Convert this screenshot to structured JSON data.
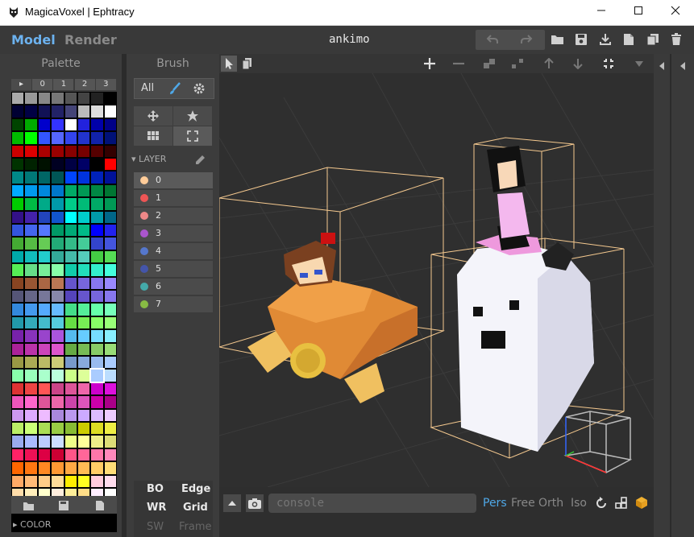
{
  "window": {
    "title": "MagicaVoxel | Ephtracy"
  },
  "header": {
    "model_tab": "Model",
    "render_tab": "Render",
    "doc_title": "ankimo"
  },
  "palette": {
    "title": "Palette",
    "tabs": [
      "▸",
      "0",
      "1",
      "2",
      "3"
    ],
    "footer_label": "COLOR",
    "rows": [
      [
        "#aaaaaa",
        "#999999",
        "#888888",
        "#777777",
        "#555555",
        "#444444",
        "#222222",
        "#000000"
      ],
      [
        "#000033",
        "#000044",
        "#111155",
        "#222266",
        "#444477",
        "#bbbbbb",
        "#dddddd",
        "#ffffff"
      ],
      [
        "#004400",
        "#00aa00",
        "#0000cc",
        "#3333ff",
        "#ffffff",
        "#2222dd",
        "#0000aa",
        "#000088"
      ],
      [
        "#00bb00",
        "#00ff00",
        "#3355ff",
        "#5566ff",
        "#3344ee",
        "#2233cc",
        "#1122aa",
        "#001177"
      ],
      [
        "#cc0000",
        "#dd0000",
        "#aa0000",
        "#990000",
        "#880000",
        "#770000",
        "#550000",
        "#330000"
      ],
      [
        "#003300",
        "#002200",
        "#001100",
        "#000022",
        "#000044",
        "#000066",
        "#000000",
        "#ff0000"
      ],
      [
        "#008888",
        "#007777",
        "#006666",
        "#005555",
        "#0044ff",
        "#0033dd",
        "#0022bb",
        "#001199"
      ],
      [
        "#00aaff",
        "#0099ee",
        "#0088dd",
        "#0077cc",
        "#00aa66",
        "#009955",
        "#008844",
        "#007733"
      ],
      [
        "#00cc00",
        "#00bb44",
        "#00aa88",
        "#0099aa",
        "#00cc88",
        "#00bb77",
        "#00aa66",
        "#009955"
      ],
      [
        "#331188",
        "#4422aa",
        "#2244bb",
        "#1155cc",
        "#00ffff",
        "#00cccc",
        "#0099aa",
        "#006688"
      ],
      [
        "#3355dd",
        "#4466ee",
        "#5577ff",
        "#009966",
        "#00aa77",
        "#00bb88",
        "#0000ff",
        "#2222ee"
      ],
      [
        "#44aa33",
        "#55bb44",
        "#66cc55",
        "#22aa77",
        "#33bb88",
        "#44cc99",
        "#3344cc",
        "#4455dd"
      ],
      [
        "#00aaaa",
        "#11bbbb",
        "#22cccc",
        "#33aa99",
        "#44bbaa",
        "#55ccbb",
        "#44cc44",
        "#55dd55"
      ],
      [
        "#55ee55",
        "#66dd88",
        "#77ee99",
        "#88ffaa",
        "#11ccaa",
        "#22ddbb",
        "#33eecc",
        "#44ffdd"
      ],
      [
        "#884422",
        "#995533",
        "#aa6644",
        "#bb7755",
        "#6655cc",
        "#7766dd",
        "#8877ee",
        "#9988ff"
      ],
      [
        "#555577",
        "#666688",
        "#777799",
        "#8888aa",
        "#5544bb",
        "#6655cc",
        "#7766dd",
        "#8877ee"
      ],
      [
        "#3388dd",
        "#4499ee",
        "#55aaff",
        "#66bbff",
        "#44dd88",
        "#55ee99",
        "#66ffaa",
        "#77ffbb"
      ],
      [
        "#2299aa",
        "#33aabb",
        "#44bbcc",
        "#55ccdd",
        "#66dd44",
        "#77ee55",
        "#88ff66",
        "#99ff77"
      ],
      [
        "#7722aa",
        "#8833bb",
        "#9944cc",
        "#aa55dd",
        "#55bbee",
        "#66ccff",
        "#77ddff",
        "#88eeff"
      ],
      [
        "#aa2299",
        "#bb33aa",
        "#cc44bb",
        "#dd55cc",
        "#66aa44",
        "#77bb55",
        "#88cc66",
        "#99dd77"
      ],
      [
        "#999944",
        "#aaaa55",
        "#bbbb66",
        "#cccc77",
        "#7799cc",
        "#88aadd",
        "#99bbee",
        "#aaccff"
      ],
      [
        "#88ffaa",
        "#99ffbb",
        "#aaffcc",
        "#bbffdd",
        "#ccff88",
        "#ddff99",
        "#aaccff",
        "#bbddff"
      ],
      [
        "#dd3333",
        "#ee4444",
        "#ff5555",
        "#cc4488",
        "#dd5599",
        "#ee66aa",
        "#cc00cc",
        "#dd11dd"
      ],
      [
        "#ee55bb",
        "#ff66cc",
        "#dd5599",
        "#ee66aa",
        "#cc44aa",
        "#dd55bb",
        "#cc00aa",
        "#aa0088"
      ],
      [
        "#cc99ee",
        "#ddaaff",
        "#eebbff",
        "#aa88dd",
        "#bb99ee",
        "#ccaaff",
        "#ddbbff",
        "#eeccff"
      ],
      [
        "#bbee66",
        "#ccff77",
        "#aadd55",
        "#99cc44",
        "#88bb33",
        "#cccc00",
        "#dddd22",
        "#eeee44"
      ],
      [
        "#99aaee",
        "#aabbff",
        "#bbccff",
        "#ccddff",
        "#eeff88",
        "#ffff99",
        "#eeee88",
        "#dddd77"
      ],
      [
        "#ff2266",
        "#ee1155",
        "#dd0044",
        "#cc0033",
        "#ff5588",
        "#ff6699",
        "#ff77aa",
        "#ff88bb"
      ],
      [
        "#ff6600",
        "#ff7711",
        "#ff8822",
        "#ff9933",
        "#ffaa44",
        "#ffbb55",
        "#ffcc66",
        "#ffdd77"
      ],
      [
        "#ffaa66",
        "#ffbb77",
        "#ffcc88",
        "#ffdd99",
        "#ffee00",
        "#ffff22",
        "#ffccdd",
        "#ffddee"
      ],
      [
        "#ffddaa",
        "#ffeebb",
        "#ffffcc",
        "#ffeedd",
        "#ffee99",
        "#ffdd88",
        "#ffeeff",
        "#ffffff"
      ]
    ]
  },
  "brush": {
    "title": "Brush",
    "mode_label": "All",
    "layer_label": "LAYER"
  },
  "layers": [
    {
      "name": "0",
      "color": "#ffcc99"
    },
    {
      "name": "1",
      "color": "#ee5555"
    },
    {
      "name": "2",
      "color": "#ee8888"
    },
    {
      "name": "3",
      "color": "#aa55cc"
    },
    {
      "name": "4",
      "color": "#5577cc"
    },
    {
      "name": "5",
      "color": "#4455aa"
    },
    {
      "name": "6",
      "color": "#44aaaa"
    },
    {
      "name": "7",
      "color": "#88bb44"
    }
  ],
  "bottom_tools": {
    "bo": "BO",
    "edge": "Edge",
    "wr": "WR",
    "grid": "Grid",
    "sw": "SW",
    "frame": "Frame"
  },
  "console": {
    "placeholder": "console"
  },
  "view_modes": {
    "pers": "Pers",
    "free": "Free",
    "orth": "Orth",
    "iso": "Iso"
  },
  "colors": {
    "accent": "#4fa8e8",
    "selection": "#f5c98f",
    "bg": "#2b2b2b"
  }
}
